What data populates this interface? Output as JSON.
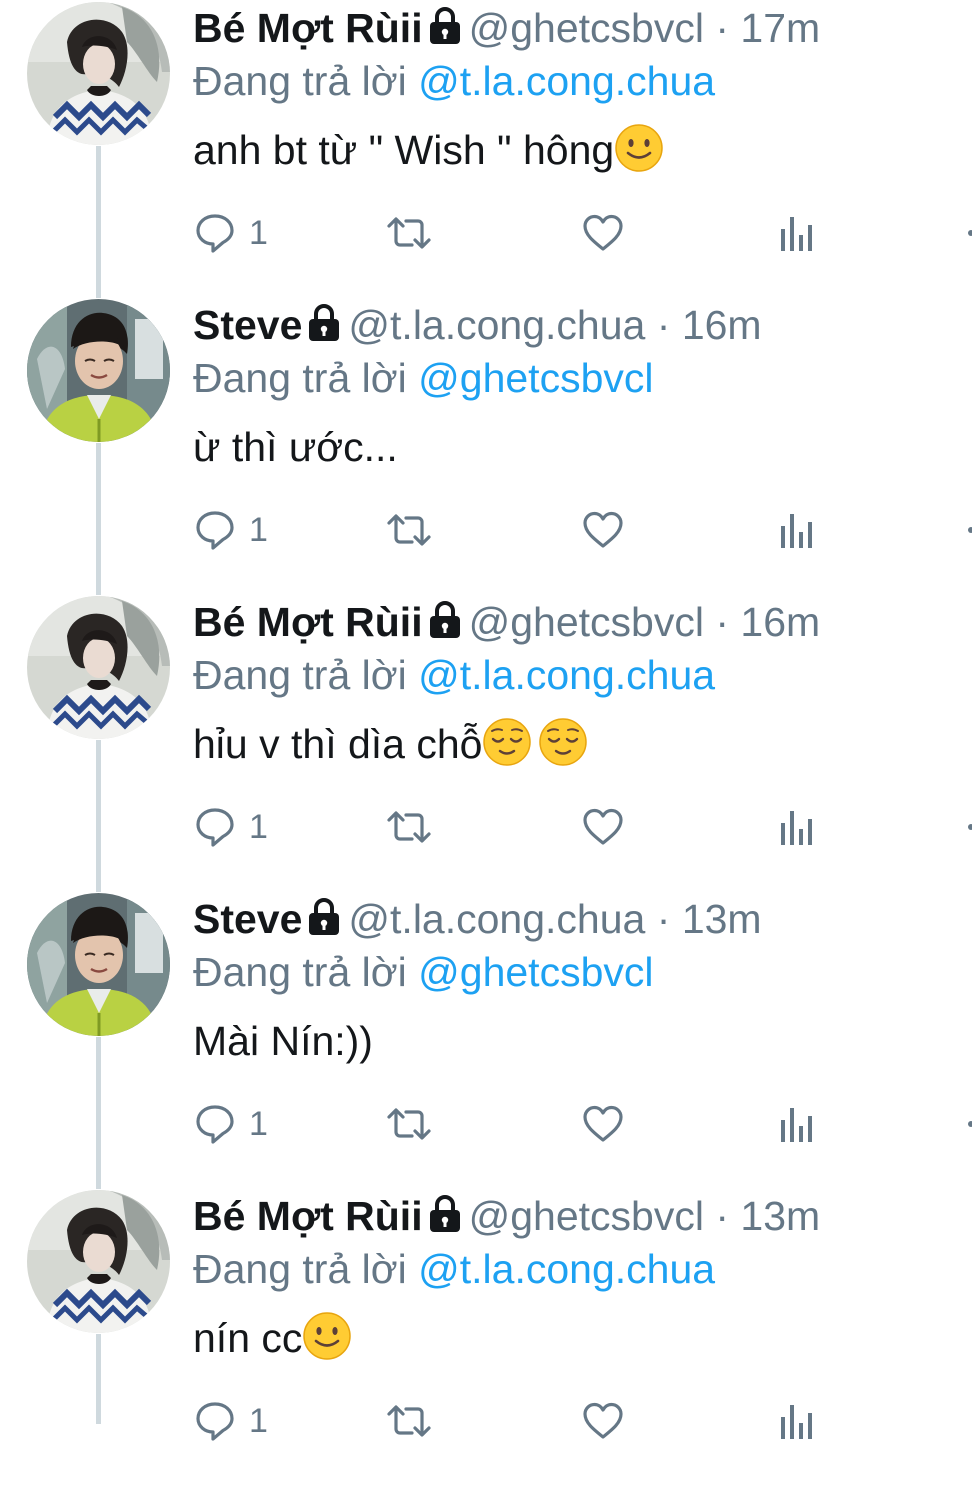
{
  "tweets": [
    {
      "name": "Bé Mợt Rùii",
      "handle": "@ghetcsbvcl",
      "separator": "·",
      "time": "17m",
      "reply_prefix": "Đang trả lời",
      "reply_to": "@t.la.cong.chua",
      "text": "anh bt từ \" Wish \" hông",
      "emojis": [
        "slightly-smiling-face-emoji"
      ],
      "reply_count": "1",
      "avatar": "avatar-photo-girl"
    },
    {
      "name": "Steve",
      "handle": "@t.la.cong.chua",
      "separator": "·",
      "time": "16m",
      "reply_prefix": "Đang trả lời",
      "reply_to": "@ghetcsbvcl",
      "text": "ừ thì ước...",
      "emojis": [],
      "reply_count": "1",
      "avatar": "avatar-photo-boy"
    },
    {
      "name": "Bé Mợt Rùii",
      "handle": "@ghetcsbvcl",
      "separator": "·",
      "time": "16m",
      "reply_prefix": "Đang trả lời",
      "reply_to": "@t.la.cong.chua",
      "text": "hỉu v thì dìa chỗ",
      "emojis": [
        "relieved-face-emoji",
        "relieved-face-emoji"
      ],
      "reply_count": "1",
      "avatar": "avatar-photo-girl"
    },
    {
      "name": "Steve",
      "handle": "@t.la.cong.chua",
      "separator": "·",
      "time": "13m",
      "reply_prefix": "Đang trả lời",
      "reply_to": "@ghetcsbvcl",
      "text": "Mài Nín:))",
      "emojis": [],
      "reply_count": "1",
      "avatar": "avatar-photo-boy"
    },
    {
      "name": "Bé Mợt Rùii",
      "handle": "@ghetcsbvcl",
      "separator": "·",
      "time": "13m",
      "reply_prefix": "Đang trả lời",
      "reply_to": "@t.la.cong.chua",
      "text": "nín cc",
      "emojis": [
        "slightly-smiling-face-emoji"
      ],
      "reply_count": "1",
      "avatar": "avatar-photo-girl"
    }
  ],
  "icons": {
    "reply": "reply-icon",
    "retweet": "retweet-icon",
    "like": "like-icon",
    "analytics": "analytics-icon",
    "protected": "lock-icon"
  },
  "colors": {
    "text_primary": "#14171a",
    "text_secondary": "#657786",
    "link": "#1da1f2",
    "thread_line": "#cfd9de",
    "emoji_yellow": "#ffcc33"
  }
}
